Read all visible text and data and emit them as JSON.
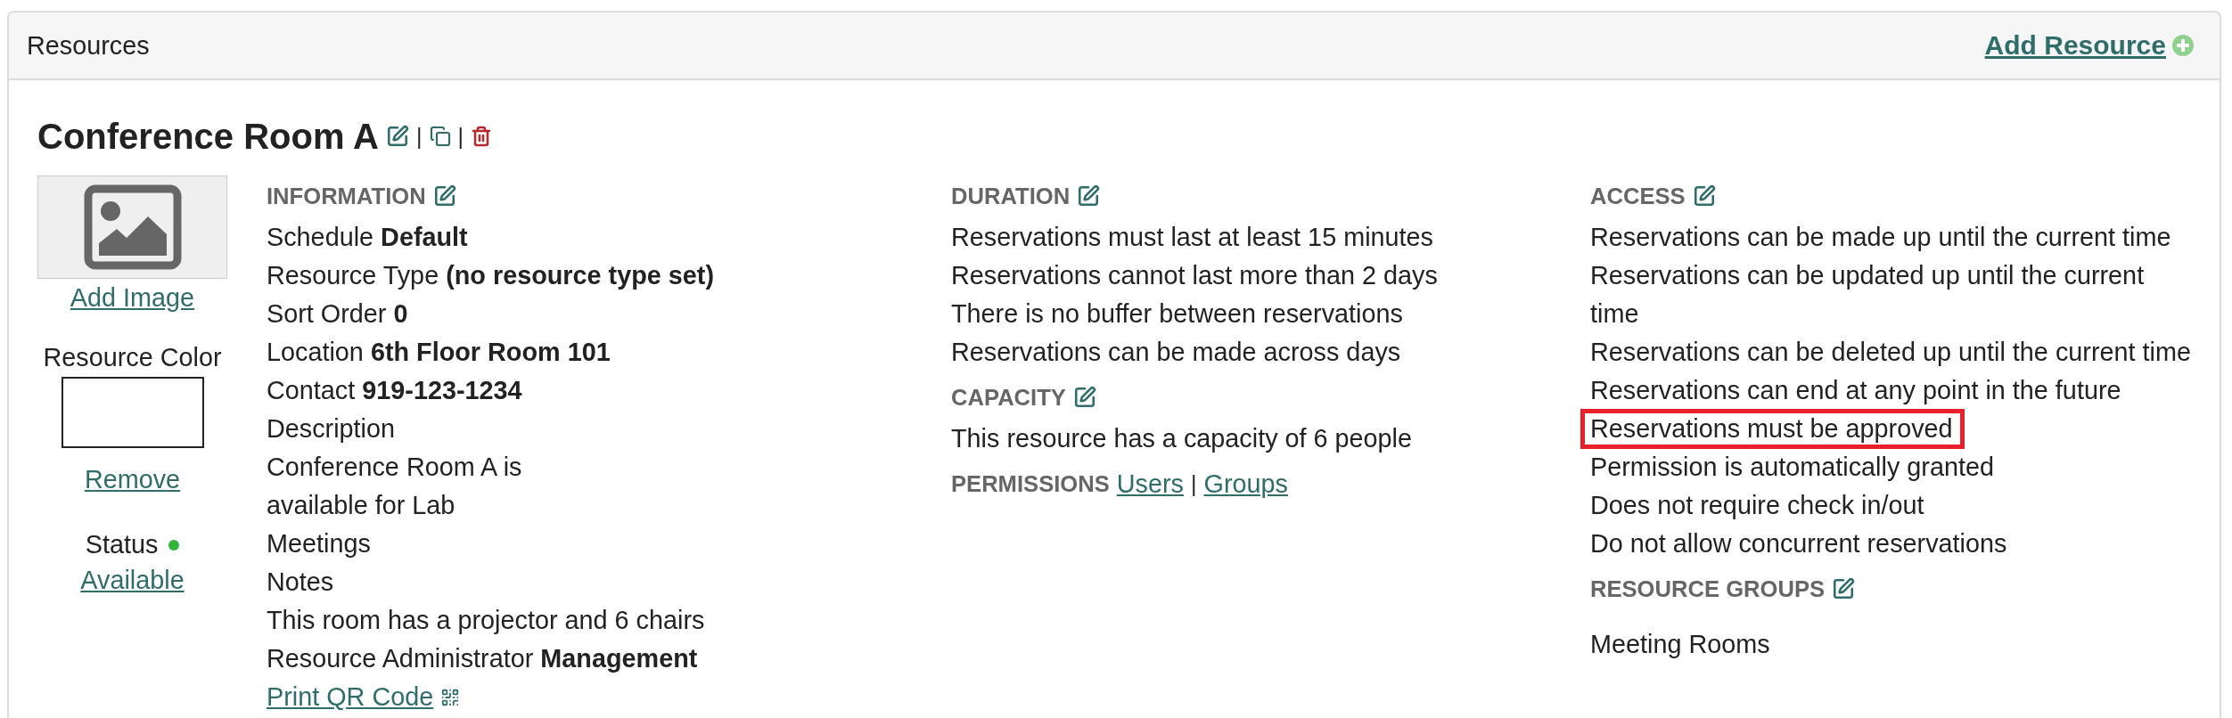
{
  "panel": {
    "title": "Resources",
    "add_link": "Add Resource"
  },
  "resource": {
    "name": "Conference Room A",
    "actions": [
      {
        "kind": "edit"
      },
      {
        "kind": "separator",
        "text": "|"
      },
      {
        "kind": "copy"
      },
      {
        "kind": "separator",
        "text": "|"
      },
      {
        "kind": "delete"
      }
    ],
    "image": {
      "kind": "placeholder",
      "link": "Add Image"
    },
    "color": {
      "label": "Resource Color",
      "link": "Remove"
    },
    "status": {
      "label": "Status",
      "value": "Available",
      "color": "#2fb53a"
    }
  },
  "columns": [
    {
      "sections": [
        {
          "heading": "INFORMATION",
          "editable": true,
          "items": [
            {
              "kind": "field",
              "label": "Schedule",
              "value": "Default"
            },
            {
              "kind": "field",
              "label": "Resource Type",
              "value": "(no resource type set)"
            },
            {
              "kind": "field",
              "label": "Sort Order",
              "value": "0"
            },
            {
              "kind": "field",
              "label": "Location",
              "value": "6th Floor Room 101"
            },
            {
              "kind": "field",
              "label": "Contact",
              "value": "919-123-1234"
            },
            {
              "kind": "line",
              "text": "Description"
            },
            {
              "kind": "line",
              "text": "Conference Room A is"
            },
            {
              "kind": "line",
              "text": "available for Lab"
            },
            {
              "kind": "line",
              "text": "Meetings"
            },
            {
              "kind": "line",
              "text": "Notes"
            },
            {
              "kind": "line",
              "text": "This room has a projector and 6 chairs"
            },
            {
              "kind": "field",
              "label": "Resource Administrator",
              "value": "Management"
            },
            {
              "kind": "qr_link",
              "text": "Print QR Code"
            }
          ]
        }
      ]
    },
    {
      "sections": [
        {
          "heading": "DURATION",
          "editable": true,
          "items": [
            {
              "kind": "line",
              "text": "Reservations must last at least 15 minutes"
            },
            {
              "kind": "line",
              "text": "Reservations cannot last more than 2 days"
            },
            {
              "kind": "line",
              "text": "There is no buffer between reservations"
            },
            {
              "kind": "line",
              "text": "Reservations can be made across days"
            }
          ]
        },
        {
          "heading": "CAPACITY",
          "editable": true,
          "items": [
            {
              "kind": "line",
              "text": "This resource has a capacity of 6 people"
            }
          ]
        },
        {
          "heading": "PERMISSIONS",
          "editable": false,
          "inline": [
            {
              "kind": "link",
              "text": "Users"
            },
            {
              "kind": "separator",
              "text": "|"
            },
            {
              "kind": "link",
              "text": "Groups"
            }
          ]
        }
      ]
    },
    {
      "sections": [
        {
          "heading": "ACCESS",
          "editable": true,
          "items": [
            {
              "kind": "line",
              "text": "Reservations can be made up until the current time",
              "highlighted": false
            },
            {
              "kind": "line",
              "text": "Reservations can be updated up until the current time",
              "highlighted": false
            },
            {
              "kind": "line",
              "text": "Reservations can be deleted up until the current time",
              "highlighted": false
            },
            {
              "kind": "line",
              "text": "Reservations can end at any point in the future",
              "highlighted": false
            },
            {
              "kind": "line",
              "text": "Reservations must be approved",
              "highlighted": true
            },
            {
              "kind": "line",
              "text": "Permission is automatically granted",
              "highlighted": false
            },
            {
              "kind": "line",
              "text": "Does not require check in/out",
              "highlighted": false
            },
            {
              "kind": "line",
              "text": "Do not allow concurrent reservations",
              "highlighted": false
            }
          ]
        },
        {
          "heading": "RESOURCE GROUPS",
          "editable": true,
          "spaced": true,
          "items": [
            {
              "kind": "line",
              "text": "Meeting Rooms"
            }
          ]
        }
      ]
    }
  ]
}
